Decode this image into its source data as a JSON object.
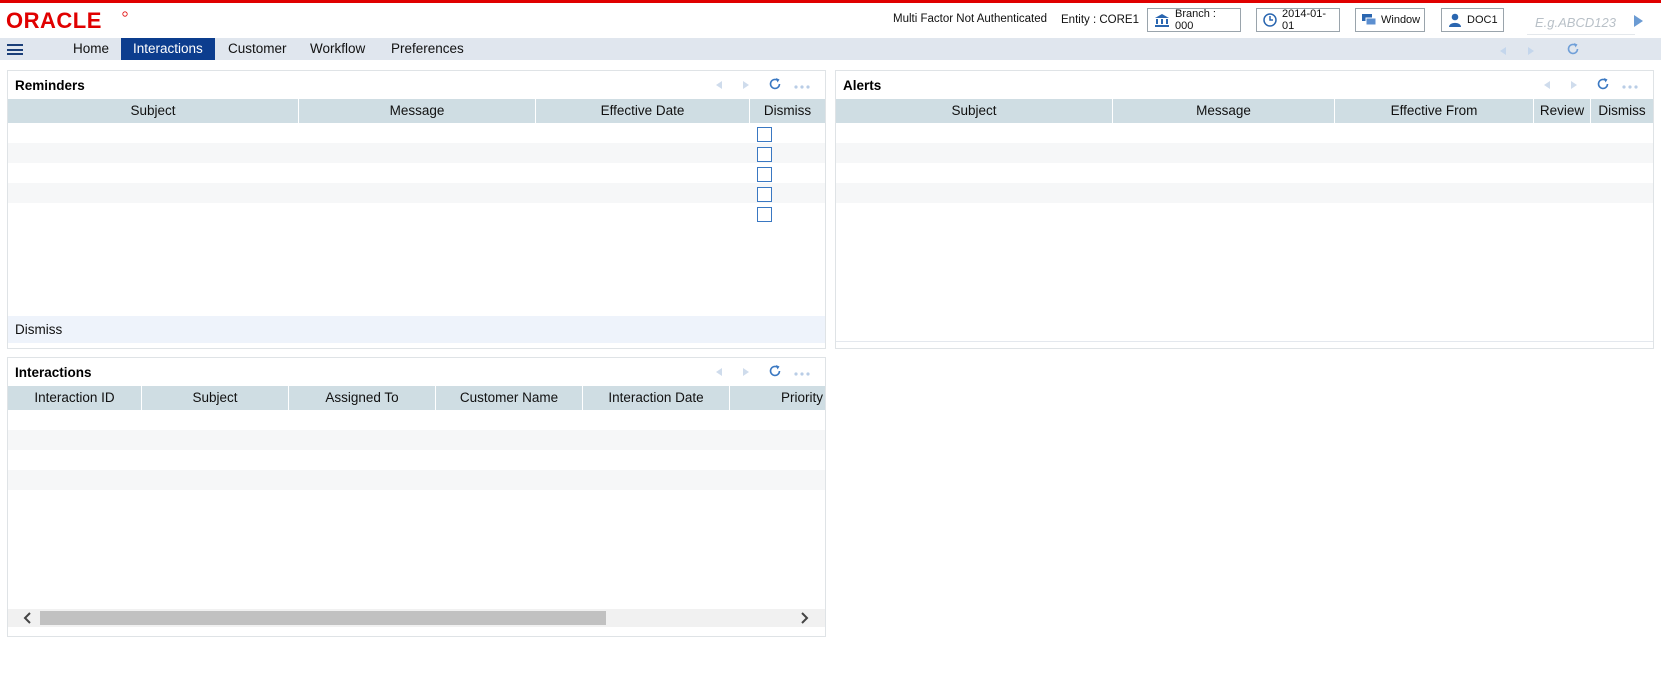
{
  "brand": {
    "logo_text": "ORACLE",
    "accent_color": "#e00000",
    "nav_active_color": "#0c3d8e",
    "table_header_color": "#cfdde3"
  },
  "header": {
    "mfa_status": "Multi Factor Not Authenticated",
    "entity": "Entity : CORE1",
    "branch": "Branch : 000",
    "date": "2014-01-01",
    "window": "Window",
    "user": "DOC1",
    "search_placeholder": "E.g.ABCD123",
    "icons": [
      "bank-icon",
      "clock-icon",
      "window-icon",
      "user-icon",
      "go-arrow-icon"
    ]
  },
  "nav": {
    "items": [
      {
        "label": "Home",
        "active": false
      },
      {
        "label": "Interactions",
        "active": true
      },
      {
        "label": "Customer",
        "active": false
      },
      {
        "label": "Workflow",
        "active": false
      },
      {
        "label": "Preferences",
        "active": false
      }
    ]
  },
  "reminders": {
    "title": "Reminders",
    "columns": [
      "Subject",
      "Message",
      "Effective Date",
      "Dismiss"
    ],
    "row_count": 5,
    "footer_label": "Dismiss"
  },
  "alerts": {
    "title": "Alerts",
    "columns": [
      "Subject",
      "Message",
      "Effective From",
      "Review",
      "Dismiss"
    ]
  },
  "interactions": {
    "title": "Interactions",
    "columns": [
      "Interaction ID",
      "Subject",
      "Assigned To",
      "Customer Name",
      "Interaction Date",
      "Priority"
    ]
  }
}
